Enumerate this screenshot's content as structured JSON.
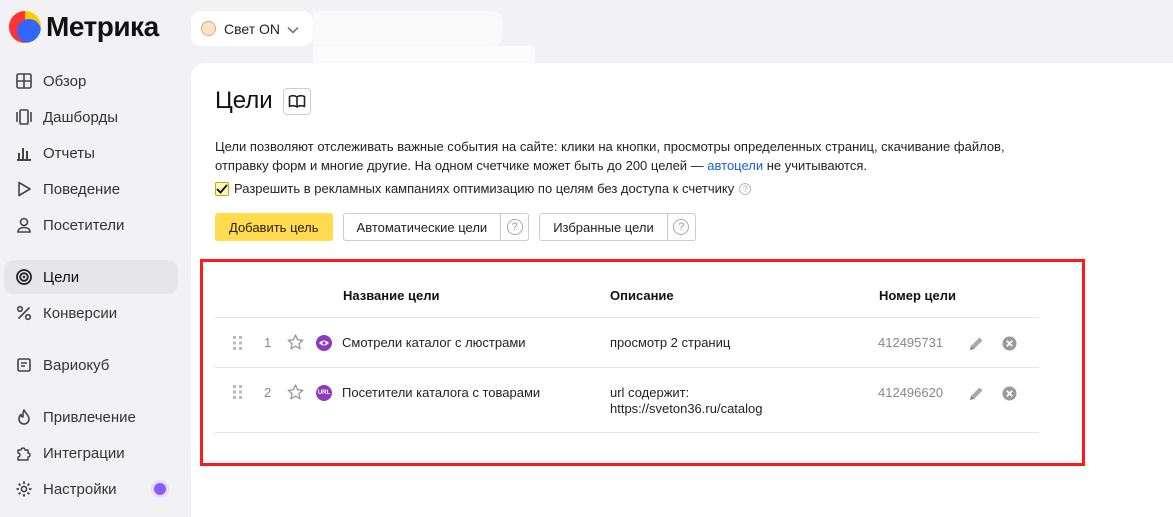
{
  "app": {
    "name": "Метрика"
  },
  "counter": {
    "name": "Свет ON"
  },
  "sidebar": {
    "items": [
      {
        "label": "Обзор",
        "icon": "grid-icon"
      },
      {
        "label": "Дашборды",
        "icon": "dashboards-icon"
      },
      {
        "label": "Отчеты",
        "icon": "bar-chart-icon"
      },
      {
        "label": "Поведение",
        "icon": "play-icon"
      },
      {
        "label": "Посетители",
        "icon": "user-icon"
      },
      {
        "label": "Цели",
        "icon": "target-icon",
        "active": true
      },
      {
        "label": "Конверсии",
        "icon": "percent-icon"
      },
      {
        "label": "Вариокуб",
        "icon": "cube-icon"
      },
      {
        "label": "Привлечение",
        "icon": "flame-icon"
      },
      {
        "label": "Интеграции",
        "icon": "puzzle-icon"
      },
      {
        "label": "Настройки",
        "icon": "gear-icon"
      }
    ]
  },
  "page": {
    "title": "Цели",
    "description_part1": "Цели позволяют отслеживать важные события на сайте: клики на кнопки, просмотры определенных страниц, скачивание файлов, отправку форм и многие другие. На одном счетчике может быть до 200 целей — ",
    "description_link": "автоцели",
    "description_part2": " не учитываются.",
    "checkbox_label": "Разрешить в рекламных кампаниях оптимизацию по целям без доступа к счетчику",
    "checkbox_checked": true
  },
  "actions": {
    "add_goal": "Добавить цель",
    "auto_goals": "Автоматические цели",
    "favorite_goals": "Избранные цели"
  },
  "table": {
    "columns": {
      "name": "Название цели",
      "description": "Описание",
      "number": "Номер цели"
    },
    "rows": [
      {
        "index": "1",
        "type_icon": "eye-icon",
        "name": "Смотрели каталог с люстрами",
        "description_line1": "просмотр 2 страниц",
        "description_line2": "",
        "goal_id": "412495731"
      },
      {
        "index": "2",
        "type_icon": "url-icon",
        "badge_text": "URL",
        "name": "Посетители каталога с товарами",
        "description_line1": "url содержит:",
        "description_line2": "https://sveton36.ru/catalog",
        "goal_id": "412496620"
      }
    ]
  },
  "colors": {
    "accent_yellow": "#ffdb4d",
    "highlight_frame": "#ff1a1a",
    "goal_badge": "#8e3bbd",
    "link": "#1b5fd1"
  }
}
